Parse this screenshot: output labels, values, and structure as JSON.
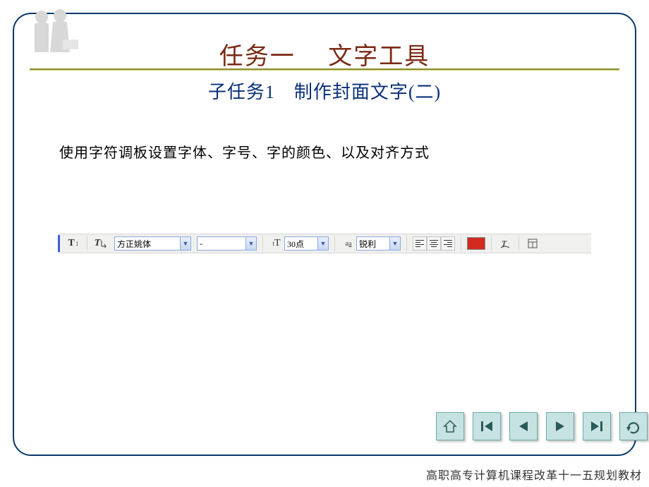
{
  "title": "任务一　 文字工具",
  "subtitle": "子任务1　制作封面文字(二)",
  "body": "使用字符调板设置字体、字号、字的颜色、以及对齐方式",
  "toolbar": {
    "orientation_glyph": "T",
    "font_family": "方正姚体",
    "font_style": "-",
    "size_glyph": "tT",
    "font_size": "30点",
    "aa_label": "aa",
    "aa_value": "锐利",
    "swatch_color": "#d22a1f"
  },
  "footer": "高职高专计算机课程改革十一五规划教材",
  "nav": {
    "home": "home",
    "first": "first",
    "prev": "prev",
    "next": "next",
    "last": "last",
    "return": "return"
  }
}
